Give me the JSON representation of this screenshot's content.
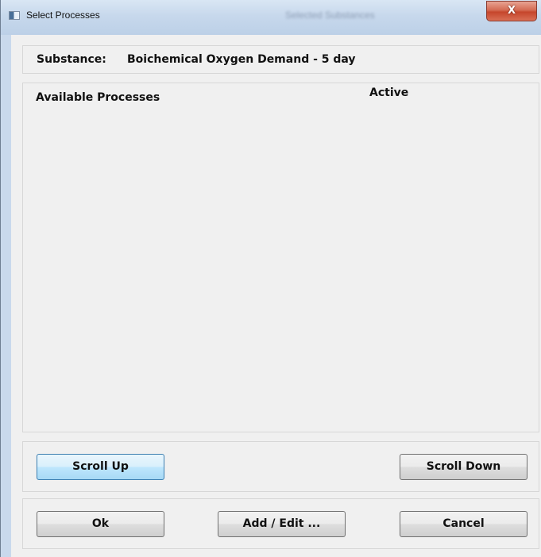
{
  "window": {
    "title": "Select Processes",
    "background_title": "Selected Substances",
    "close_glyph": "X"
  },
  "substance": {
    "label": "Substance:",
    "value": "Boichemical Oxygen Demand - 5 day"
  },
  "process_list": {
    "columns": [
      "Available Processes",
      "Active"
    ],
    "rows": []
  },
  "buttons": {
    "scroll_up": "Scroll Up",
    "scroll_down": "Scroll Down",
    "ok": "Ok",
    "add_edit": "Add / Edit ...",
    "cancel": "Cancel"
  },
  "colors": {
    "titlebar": "#c7d8ec",
    "close_button": "#c6462c",
    "dialog_background": "#f0f0f0",
    "focused_button": "#bee6fd"
  },
  "icons": {
    "window_icon": "application-window-icon",
    "close": "close-icon"
  }
}
